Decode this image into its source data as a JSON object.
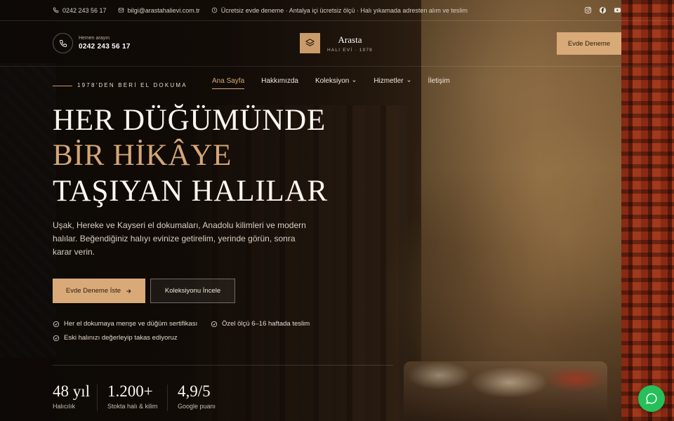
{
  "topbar": {
    "phone": "0242 243 56 17",
    "email": "bilgi@arastahalievi.com.tr",
    "notice": "Ücretsiz evde deneme · Antalya içi ücretsiz ölçü · Halı yıkamada adresten alım ve teslim",
    "social": [
      "instagram-icon",
      "facebook-icon",
      "youtube-icon"
    ]
  },
  "header": {
    "phone_label": "Hemen arayın",
    "phone_number": "0242 243 56 17",
    "logo_name": "Arasta",
    "logo_sub": "HALI EVİ · 1978",
    "cta": "Evde Deneme"
  },
  "nav": {
    "items": [
      {
        "label": "Ana Sayfa"
      },
      {
        "label": "Hakkımızda"
      },
      {
        "label": "Koleksiyon"
      },
      {
        "label": "Hizmetler"
      },
      {
        "label": "İletişim"
      }
    ]
  },
  "hero": {
    "eyebrow": "1978'DEN BERİ EL DOKUMA",
    "line1": "HER DÜĞÜMÜNDE",
    "line2": "BİR HİKÂYE",
    "line3": "TAŞIYAN HALILAR",
    "lead": "Uşak, Hereke ve Kayseri el dokumaları, Anadolu kilimleri ve modern halılar. Beğendiğiniz halıyı evinize getirelim, yerinde görün, sonra karar verin.",
    "primary_button": "Evde Deneme İste",
    "secondary_button": "Koleksiyonu İncele",
    "features": [
      "Her el dokumaya menşe ve düğüm sertifikası",
      "Özel ölçü 6–16 haftada teslim",
      "Eski halınızı değerleyip takas ediyoruz"
    ]
  },
  "stats": [
    {
      "value": "48 yıl",
      "label": "Halıcılık"
    },
    {
      "value": "1.200+",
      "label": "Stokta halı & kilim"
    },
    {
      "value": "4,9/5",
      "label": "Google puanı"
    }
  ],
  "colors": {
    "accent": "#d9aa78",
    "whatsapp": "#25c05a"
  }
}
